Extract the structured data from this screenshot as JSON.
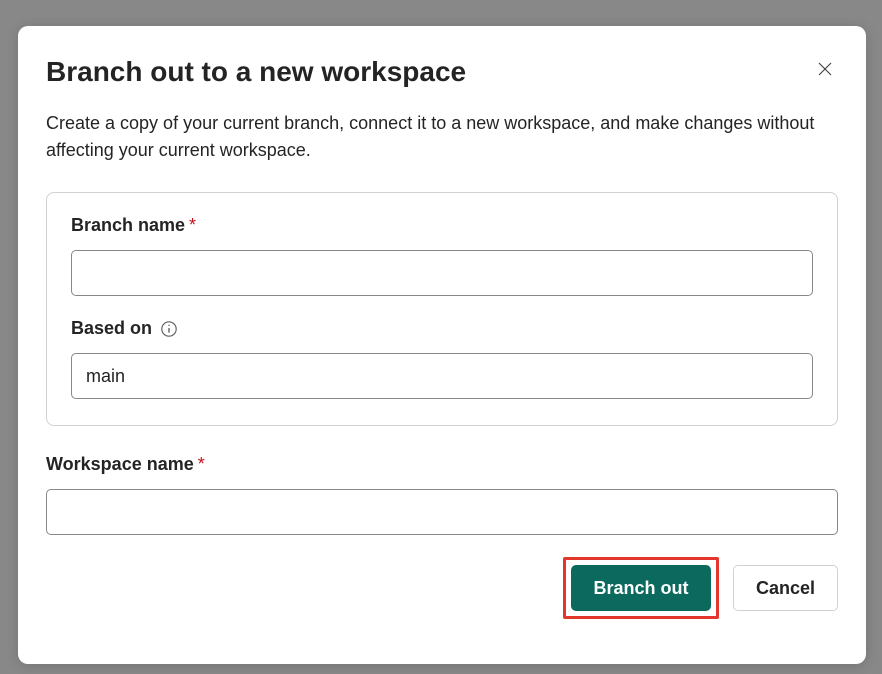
{
  "dialog": {
    "title": "Branch out to a new workspace",
    "description": "Create a copy of your current branch, connect it to a new workspace, and make changes without affecting your current workspace."
  },
  "fields": {
    "branchName": {
      "label": "Branch name",
      "required": "*",
      "value": ""
    },
    "basedOn": {
      "label": "Based on",
      "value": "main"
    },
    "workspaceName": {
      "label": "Workspace name",
      "required": "*",
      "value": ""
    }
  },
  "buttons": {
    "primary": "Branch out",
    "secondary": "Cancel"
  }
}
